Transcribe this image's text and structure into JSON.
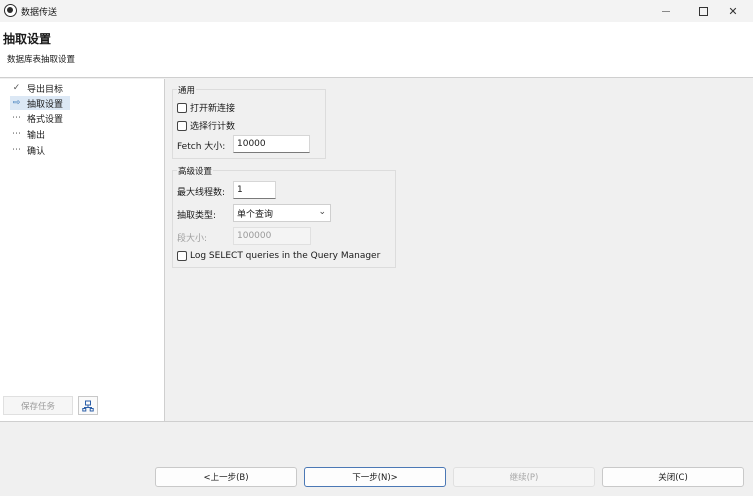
{
  "window": {
    "title": "数据传送",
    "min_icon": "minimize-icon",
    "max_icon": "maximize-icon",
    "close_glyph": "✕"
  },
  "header": {
    "title": "抽取设置",
    "subtitle": "数据库表抽取设置"
  },
  "nav": {
    "items": [
      {
        "label": "导出目标",
        "icon": "✓",
        "state": "done"
      },
      {
        "label": "抽取设置",
        "icon": "⇨",
        "state": "current"
      },
      {
        "label": "格式设置",
        "icon": "⋯",
        "state": "pending"
      },
      {
        "label": "输出",
        "icon": "⋯",
        "state": "pending"
      },
      {
        "label": "确认",
        "icon": "⋯",
        "state": "pending"
      }
    ],
    "save_task_label": "保存任务"
  },
  "general": {
    "group_label": "通用",
    "open_new_connection": "打开新连接",
    "select_row_count": "选择行计数",
    "fetch_size_label": "Fetch 大小:",
    "fetch_size_value": "10000"
  },
  "advanced": {
    "group_label": "高级设置",
    "max_threads_label": "最大线程数:",
    "max_threads_value": "1",
    "extract_type_label": "抽取类型:",
    "extract_type_value": "单个查询",
    "segment_size_label": "段大小:",
    "segment_size_value": "100000",
    "log_select_label": "Log SELECT queries in the Query Manager"
  },
  "buttons": {
    "back": "<上一步(B)",
    "next": "下一步(N)>",
    "proceed": "继续(P)",
    "close": "关闭(C)"
  },
  "colors": {
    "accent": "#4b78b5",
    "nav_active": "#dce8f5"
  }
}
